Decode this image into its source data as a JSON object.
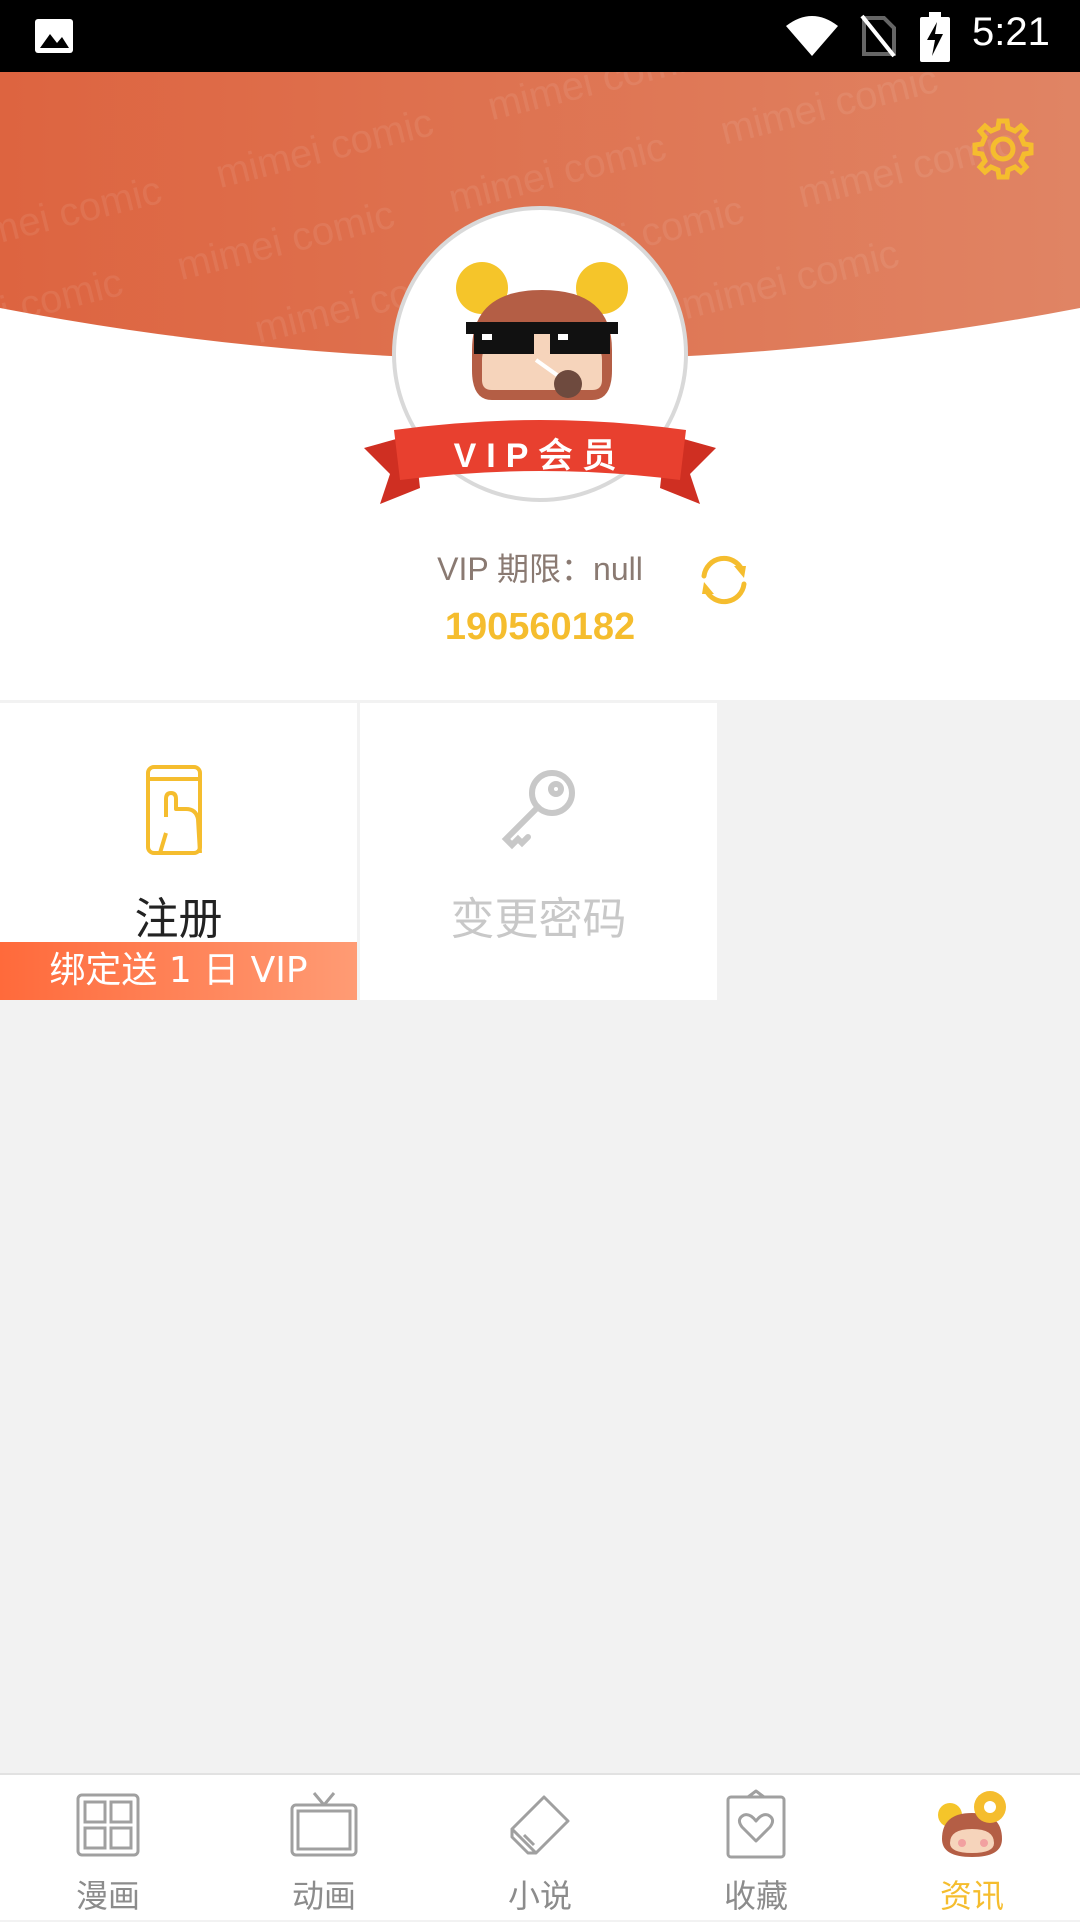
{
  "status_bar": {
    "time": "5:21",
    "icons": [
      "gallery-icon",
      "wifi-icon",
      "no-sim-icon",
      "battery-charging-icon"
    ]
  },
  "header": {
    "watermark_text": "mimei comic",
    "settings_icon": "gear-icon",
    "avatar_icon": "avatar-icon",
    "vip_badge": "VIP会员",
    "vip_expiry": "VIP 期限：null",
    "user_id": "190560182",
    "refresh_icon": "refresh-icon"
  },
  "tiles": [
    {
      "title": "注册",
      "icon": "phone-touch-icon",
      "badge": "绑定送 1 日 VIP",
      "enabled": true
    },
    {
      "title": "变更密码",
      "icon": "key-icon",
      "enabled": false
    }
  ],
  "bottom_nav": {
    "items": [
      {
        "label": "漫画",
        "icon": "comic-grid-icon",
        "active": false
      },
      {
        "label": "动画",
        "icon": "tv-icon",
        "active": false
      },
      {
        "label": "小说",
        "icon": "book-icon",
        "active": false
      },
      {
        "label": "收藏",
        "icon": "favorite-icon",
        "active": false
      },
      {
        "label": "资讯",
        "icon": "mascot-settings-icon",
        "active": true
      }
    ]
  },
  "colors": {
    "header_orange": "#e06a45",
    "accent_yellow": "#f5bd2e",
    "ribbon_red": "#e8402f",
    "badge_gradient_start": "#ff6a3b",
    "badge_gradient_end": "#ff9b74",
    "background": "#f2f2f2"
  }
}
